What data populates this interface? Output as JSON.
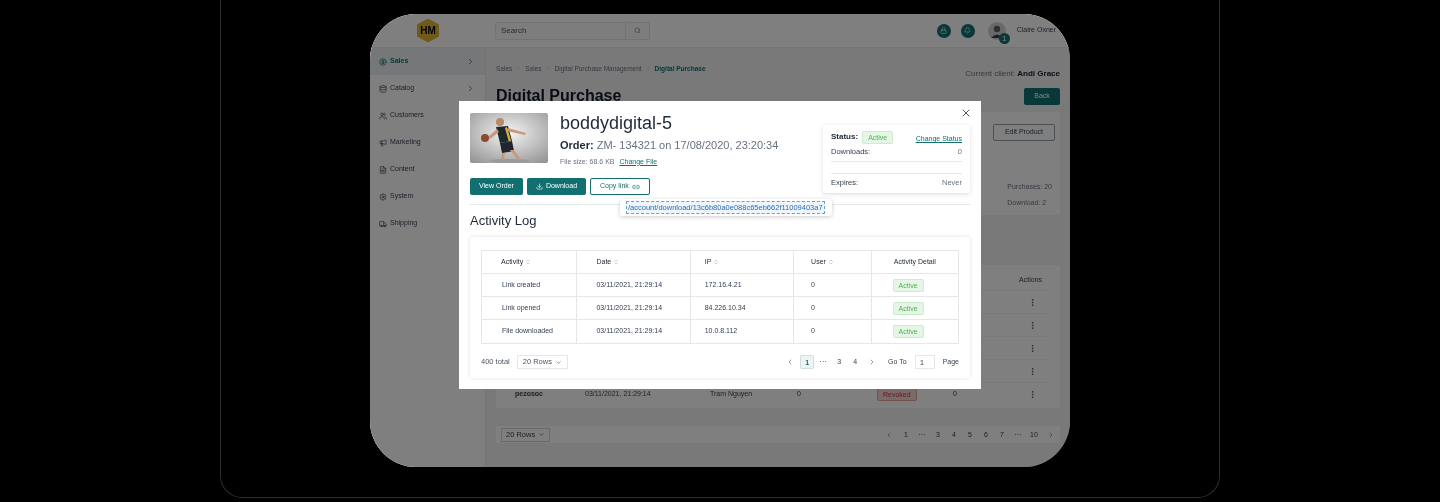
{
  "topbar": {
    "logo": "HM",
    "search": {
      "placeholder": "Search"
    },
    "user": {
      "name": "Claire Oxner",
      "badge": "1"
    }
  },
  "sidebar": {
    "items": [
      {
        "label": "Sales",
        "selected": true,
        "expandable": true
      },
      {
        "label": "Catalog",
        "selected": false,
        "expandable": true
      },
      {
        "label": "Customers",
        "selected": false
      },
      {
        "label": "Marketing",
        "selected": false
      },
      {
        "label": "Content",
        "selected": false
      },
      {
        "label": "System",
        "selected": false
      },
      {
        "label": "Shipping",
        "selected": false
      }
    ]
  },
  "breadcrumb": [
    {
      "label": "Sales",
      "selected": false
    },
    {
      "label": "Sales",
      "selected": false
    },
    {
      "label": "Digital Purchase Management",
      "selected": false
    },
    {
      "label": "Digital Purchase",
      "selected": true
    }
  ],
  "current_client": {
    "label": "Current client:",
    "name": "Andi Grace"
  },
  "page_title": "Digital Purchase",
  "back_button": "Back",
  "edit_button": "Edit Product",
  "stats": [
    "Purchases: 20",
    "Download: 2"
  ],
  "background_table": {
    "actions_header": "Actions",
    "rows": [
      {
        "kind": "covered"
      },
      {
        "kind": "covered"
      },
      {
        "kind": "covered"
      },
      {
        "kind": "covered"
      },
      {
        "kind": "full",
        "cells": [
          "pezosoc",
          "03/11/2021, 21:29:14",
          "Tram Nguyen",
          "0"
        ],
        "status": {
          "label": "Revoked",
          "kind": "revoked"
        },
        "count": "0"
      }
    ]
  },
  "background_pagination": {
    "rows": "20 Rows",
    "pages": [
      {
        "label": "1",
        "selected": false
      },
      {
        "label": "···",
        "selected": false
      },
      {
        "label": "3",
        "selected": false
      },
      {
        "label": "4",
        "selected": false
      },
      {
        "label": "5",
        "selected": false
      },
      {
        "label": "6",
        "selected": false
      },
      {
        "label": "7",
        "selected": false
      },
      {
        "label": "···",
        "selected": false
      },
      {
        "label": "10",
        "selected": false
      }
    ]
  },
  "modal": {
    "title": "boddydigital-5",
    "order_label": "Order:",
    "order_value": "ZM- 134321 on 17/08/2020, 23:20:34",
    "file_size": "File size: 68.6 KB",
    "change_file": "Change File",
    "buttons": [
      {
        "label": "View Order",
        "kind": "primary"
      },
      {
        "label": "Download",
        "kind": "download"
      },
      {
        "label": "Copy link",
        "kind": "link"
      }
    ],
    "link_popover": "/account/download/13c6b80a0e088c65eb662f11009403a7",
    "status_card": {
      "label": "Status:",
      "value": {
        "label": "Active",
        "kind": "active"
      },
      "change": "Change Status",
      "rows": [
        {
          "label": "Downloads:",
          "value": "0"
        },
        {
          "label": "Expires:",
          "value": "Never"
        }
      ]
    },
    "activity_log": {
      "title": "Activity Log",
      "columns": [
        {
          "label": "Activity",
          "sortable": true
        },
        {
          "label": "Date",
          "sortable": true
        },
        {
          "label": "IP",
          "sortable": true
        },
        {
          "label": "User",
          "sortable": true
        },
        {
          "label": "Activity Detail",
          "sortable": false
        }
      ],
      "rows": [
        {
          "cells": [
            "Link created",
            "03/11/2021, 21:29:14",
            "172.16.4.21",
            "0"
          ],
          "detail": {
            "label": "Active",
            "kind": "active"
          }
        },
        {
          "cells": [
            "Link opened",
            "03/11/2021, 21:29:14",
            "84.226.10.34",
            "0"
          ],
          "detail": {
            "label": "Active",
            "kind": "active"
          }
        },
        {
          "cells": [
            "File downloaded",
            "03/11/2021, 21:29:14",
            "10.0.8.112",
            "0"
          ],
          "detail": {
            "label": "Active",
            "kind": "active"
          }
        }
      ],
      "total": "400 total",
      "rows_select": "20 Rows",
      "pages": [
        {
          "label": "1",
          "selected": true
        },
        {
          "label": "···",
          "selected": false
        },
        {
          "label": "3",
          "selected": false
        },
        {
          "label": "4",
          "selected": false
        }
      ],
      "goto_label": "Go To",
      "goto": {
        "placeholder": "1"
      },
      "page_label": "Page"
    }
  }
}
